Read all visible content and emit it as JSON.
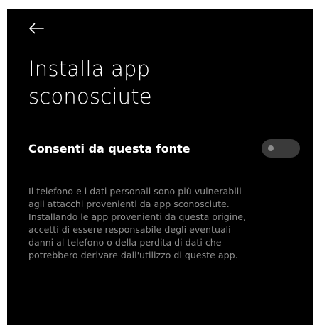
{
  "header": {
    "back_icon": "back-arrow-icon",
    "title": "Installa app\nsconosciute"
  },
  "setting": {
    "label": "Consenti da questa fonte",
    "enabled": false
  },
  "description": "Il telefono e i dati personali sono più vulnerabili\nagli attacchi provenienti da app sconosciute.\nInstallando le app provenienti da questa origine,\naccetti di essere responsabile degli eventuali\ndanni al telefono o della perdita di dati che\npotrebbero derivare dall'utilizzo di queste app.",
  "colors": {
    "background": "#000000",
    "text": "#ffffff",
    "secondary_text": "#8f8f8f",
    "toggle_track": "#3a3a3a",
    "toggle_knob": "#8c8c8c"
  }
}
